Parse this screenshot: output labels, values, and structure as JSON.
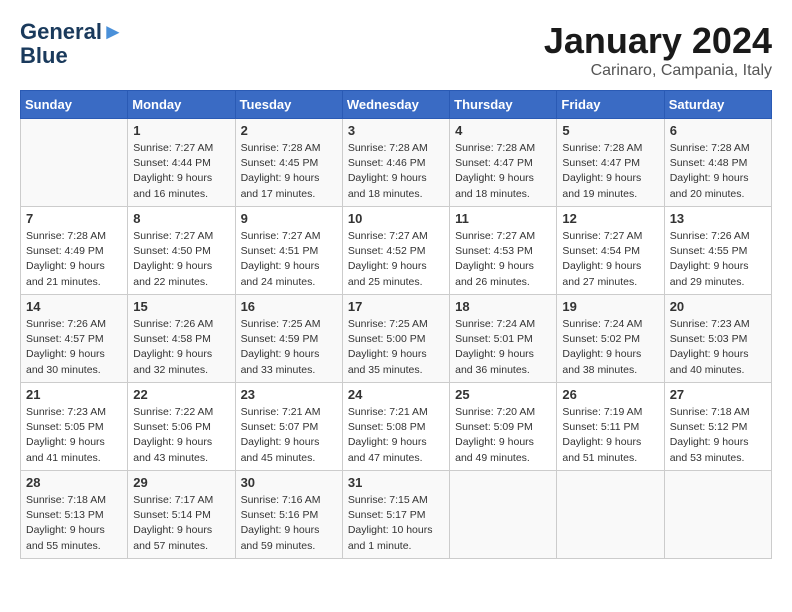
{
  "header": {
    "logo_line1": "General",
    "logo_line2": "Blue",
    "month": "January 2024",
    "location": "Carinaro, Campania, Italy"
  },
  "weekdays": [
    "Sunday",
    "Monday",
    "Tuesday",
    "Wednesday",
    "Thursday",
    "Friday",
    "Saturday"
  ],
  "weeks": [
    [
      {
        "day": "",
        "info": ""
      },
      {
        "day": "1",
        "info": "Sunrise: 7:27 AM\nSunset: 4:44 PM\nDaylight: 9 hours\nand 16 minutes."
      },
      {
        "day": "2",
        "info": "Sunrise: 7:28 AM\nSunset: 4:45 PM\nDaylight: 9 hours\nand 17 minutes."
      },
      {
        "day": "3",
        "info": "Sunrise: 7:28 AM\nSunset: 4:46 PM\nDaylight: 9 hours\nand 18 minutes."
      },
      {
        "day": "4",
        "info": "Sunrise: 7:28 AM\nSunset: 4:47 PM\nDaylight: 9 hours\nand 18 minutes."
      },
      {
        "day": "5",
        "info": "Sunrise: 7:28 AM\nSunset: 4:47 PM\nDaylight: 9 hours\nand 19 minutes."
      },
      {
        "day": "6",
        "info": "Sunrise: 7:28 AM\nSunset: 4:48 PM\nDaylight: 9 hours\nand 20 minutes."
      }
    ],
    [
      {
        "day": "7",
        "info": "Sunrise: 7:28 AM\nSunset: 4:49 PM\nDaylight: 9 hours\nand 21 minutes."
      },
      {
        "day": "8",
        "info": "Sunrise: 7:27 AM\nSunset: 4:50 PM\nDaylight: 9 hours\nand 22 minutes."
      },
      {
        "day": "9",
        "info": "Sunrise: 7:27 AM\nSunset: 4:51 PM\nDaylight: 9 hours\nand 24 minutes."
      },
      {
        "day": "10",
        "info": "Sunrise: 7:27 AM\nSunset: 4:52 PM\nDaylight: 9 hours\nand 25 minutes."
      },
      {
        "day": "11",
        "info": "Sunrise: 7:27 AM\nSunset: 4:53 PM\nDaylight: 9 hours\nand 26 minutes."
      },
      {
        "day": "12",
        "info": "Sunrise: 7:27 AM\nSunset: 4:54 PM\nDaylight: 9 hours\nand 27 minutes."
      },
      {
        "day": "13",
        "info": "Sunrise: 7:26 AM\nSunset: 4:55 PM\nDaylight: 9 hours\nand 29 minutes."
      }
    ],
    [
      {
        "day": "14",
        "info": "Sunrise: 7:26 AM\nSunset: 4:57 PM\nDaylight: 9 hours\nand 30 minutes."
      },
      {
        "day": "15",
        "info": "Sunrise: 7:26 AM\nSunset: 4:58 PM\nDaylight: 9 hours\nand 32 minutes."
      },
      {
        "day": "16",
        "info": "Sunrise: 7:25 AM\nSunset: 4:59 PM\nDaylight: 9 hours\nand 33 minutes."
      },
      {
        "day": "17",
        "info": "Sunrise: 7:25 AM\nSunset: 5:00 PM\nDaylight: 9 hours\nand 35 minutes."
      },
      {
        "day": "18",
        "info": "Sunrise: 7:24 AM\nSunset: 5:01 PM\nDaylight: 9 hours\nand 36 minutes."
      },
      {
        "day": "19",
        "info": "Sunrise: 7:24 AM\nSunset: 5:02 PM\nDaylight: 9 hours\nand 38 minutes."
      },
      {
        "day": "20",
        "info": "Sunrise: 7:23 AM\nSunset: 5:03 PM\nDaylight: 9 hours\nand 40 minutes."
      }
    ],
    [
      {
        "day": "21",
        "info": "Sunrise: 7:23 AM\nSunset: 5:05 PM\nDaylight: 9 hours\nand 41 minutes."
      },
      {
        "day": "22",
        "info": "Sunrise: 7:22 AM\nSunset: 5:06 PM\nDaylight: 9 hours\nand 43 minutes."
      },
      {
        "day": "23",
        "info": "Sunrise: 7:21 AM\nSunset: 5:07 PM\nDaylight: 9 hours\nand 45 minutes."
      },
      {
        "day": "24",
        "info": "Sunrise: 7:21 AM\nSunset: 5:08 PM\nDaylight: 9 hours\nand 47 minutes."
      },
      {
        "day": "25",
        "info": "Sunrise: 7:20 AM\nSunset: 5:09 PM\nDaylight: 9 hours\nand 49 minutes."
      },
      {
        "day": "26",
        "info": "Sunrise: 7:19 AM\nSunset: 5:11 PM\nDaylight: 9 hours\nand 51 minutes."
      },
      {
        "day": "27",
        "info": "Sunrise: 7:18 AM\nSunset: 5:12 PM\nDaylight: 9 hours\nand 53 minutes."
      }
    ],
    [
      {
        "day": "28",
        "info": "Sunrise: 7:18 AM\nSunset: 5:13 PM\nDaylight: 9 hours\nand 55 minutes."
      },
      {
        "day": "29",
        "info": "Sunrise: 7:17 AM\nSunset: 5:14 PM\nDaylight: 9 hours\nand 57 minutes."
      },
      {
        "day": "30",
        "info": "Sunrise: 7:16 AM\nSunset: 5:16 PM\nDaylight: 9 hours\nand 59 minutes."
      },
      {
        "day": "31",
        "info": "Sunrise: 7:15 AM\nSunset: 5:17 PM\nDaylight: 10 hours\nand 1 minute."
      },
      {
        "day": "",
        "info": ""
      },
      {
        "day": "",
        "info": ""
      },
      {
        "day": "",
        "info": ""
      }
    ]
  ]
}
